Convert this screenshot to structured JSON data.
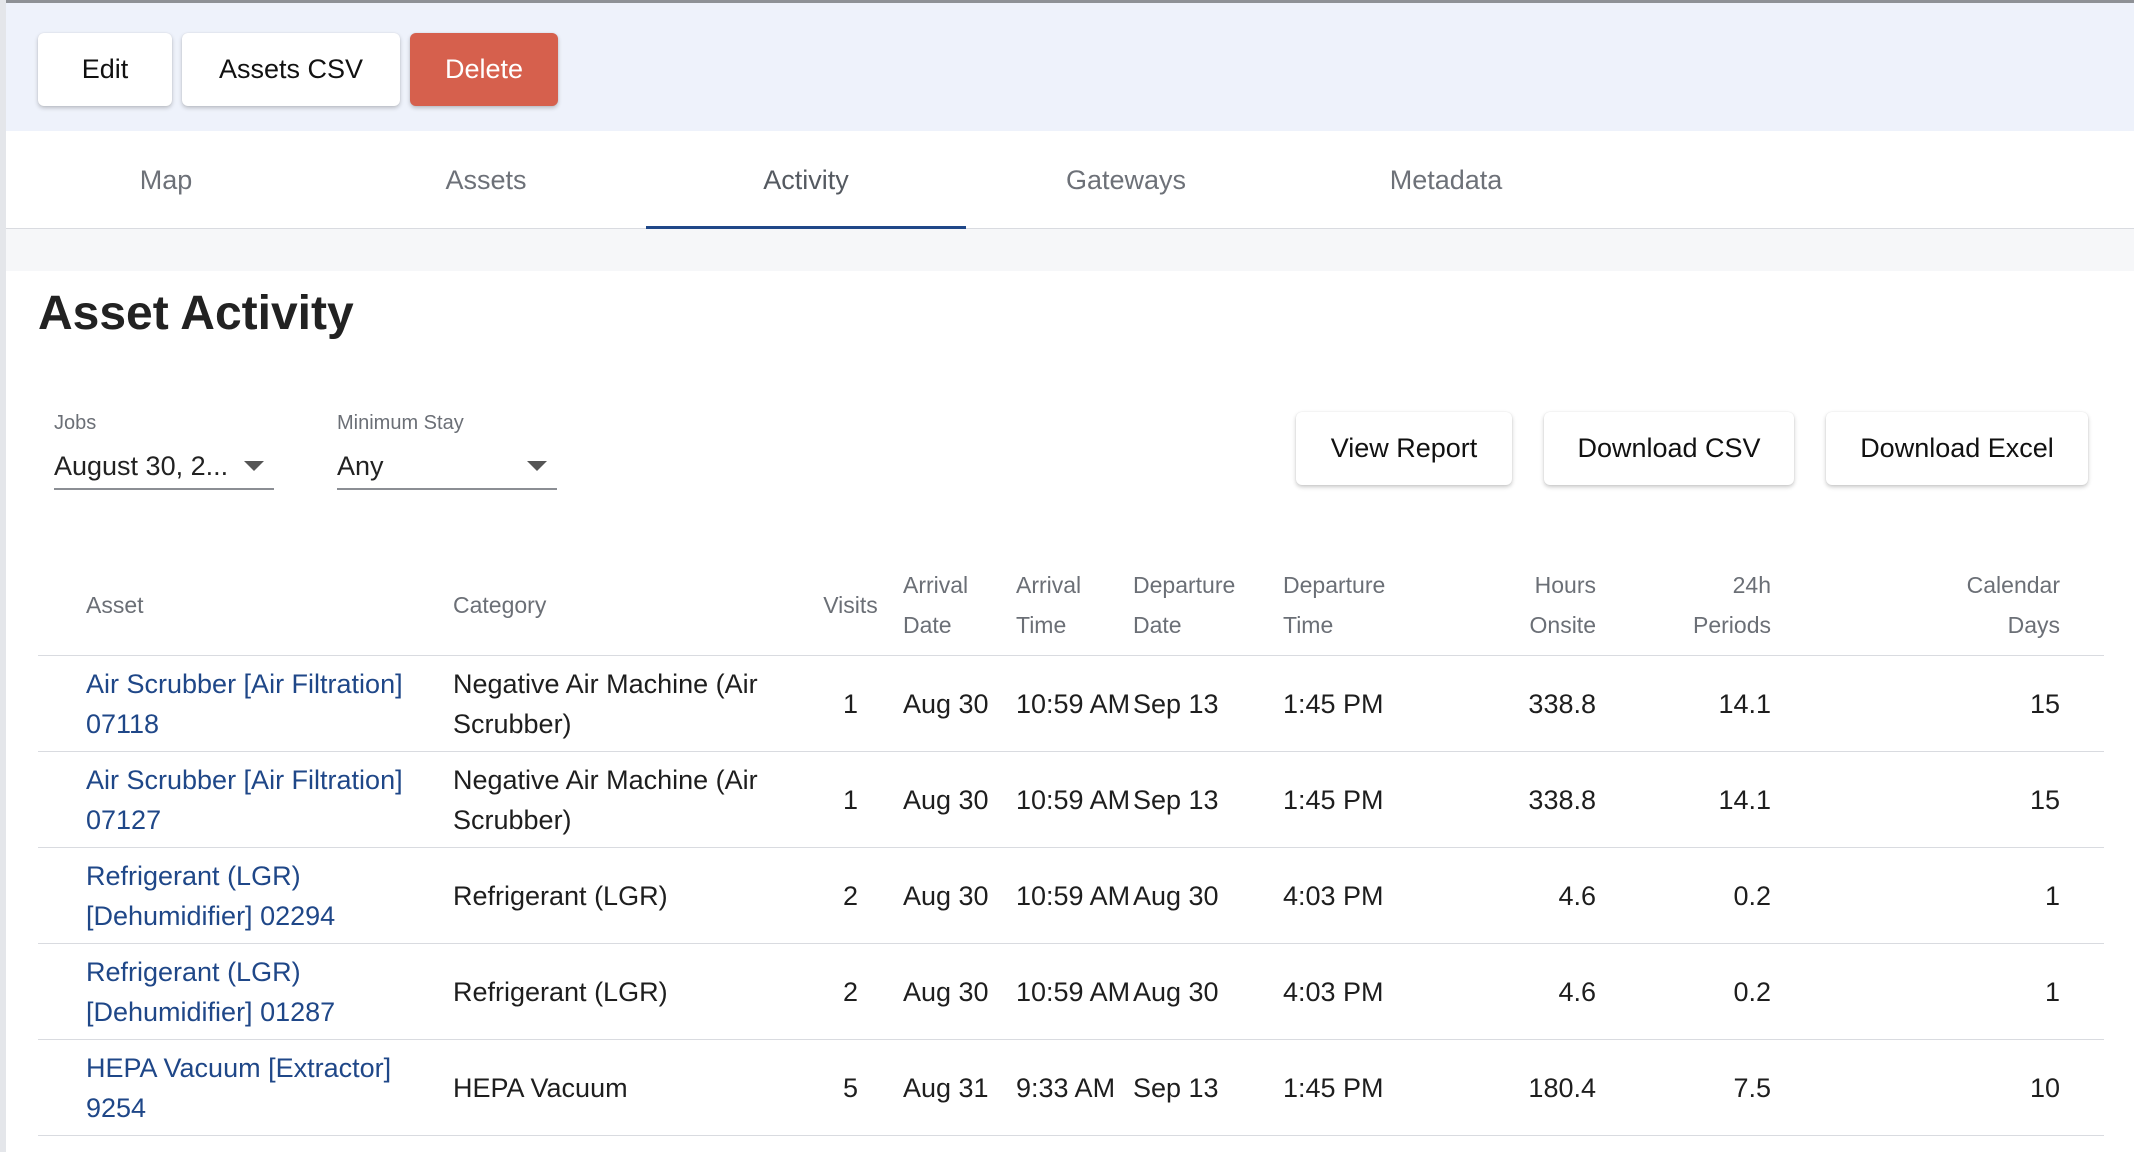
{
  "toolbar": {
    "edit_label": "Edit",
    "assets_csv_label": "Assets CSV",
    "delete_label": "Delete",
    "delete_color": "#d6604d"
  },
  "tabs": [
    {
      "label": "Map",
      "active": false
    },
    {
      "label": "Assets",
      "active": false
    },
    {
      "label": "Activity",
      "active": true
    },
    {
      "label": "Gateways",
      "active": false
    },
    {
      "label": "Metadata",
      "active": false
    }
  ],
  "accent_color": "#1f4788",
  "page_title": "Asset Activity",
  "filters": {
    "jobs": {
      "label": "Jobs",
      "value": "August 30, 2..."
    },
    "minimum_stay": {
      "label": "Minimum Stay",
      "value": "Any"
    }
  },
  "actions": {
    "view_report": "View Report",
    "download_csv": "Download CSV",
    "download_excel": "Download Excel"
  },
  "table": {
    "headers": {
      "asset": "Asset",
      "category": "Category",
      "visits": "Visits",
      "arrival_date": [
        "Arrival",
        "Date"
      ],
      "arrival_time": [
        "Arrival",
        "Time"
      ],
      "departure_date": [
        "Departure",
        "Date"
      ],
      "departure_time": [
        "Departure",
        "Time"
      ],
      "hours_onsite": [
        "Hours",
        "Onsite"
      ],
      "periods_24h": [
        "24h",
        "Periods"
      ],
      "calendar_days": [
        "Calendar",
        "Days"
      ]
    },
    "rows": [
      {
        "asset": "Air Scrubber [Air Filtration] 07118",
        "category": "Negative Air Machine (Air Scrubber)",
        "visits": "1",
        "arrival_date": "Aug 30",
        "arrival_time": "10:59 AM",
        "departure_date": "Sep 13",
        "departure_time": "1:45 PM",
        "hours_onsite": "338.8",
        "periods_24h": "14.1",
        "calendar_days": "15"
      },
      {
        "asset": "Air Scrubber [Air Filtration] 07127",
        "category": "Negative Air Machine (Air Scrubber)",
        "visits": "1",
        "arrival_date": "Aug 30",
        "arrival_time": "10:59 AM",
        "departure_date": "Sep 13",
        "departure_time": "1:45 PM",
        "hours_onsite": "338.8",
        "periods_24h": "14.1",
        "calendar_days": "15"
      },
      {
        "asset": "Refrigerant (LGR) [Dehumidifier] 02294",
        "category": "Refrigerant (LGR)",
        "visits": "2",
        "arrival_date": "Aug 30",
        "arrival_time": "10:59 AM",
        "departure_date": "Aug 30",
        "departure_time": "4:03 PM",
        "hours_onsite": "4.6",
        "periods_24h": "0.2",
        "calendar_days": "1"
      },
      {
        "asset": "Refrigerant (LGR) [Dehumidifier] 01287",
        "category": "Refrigerant (LGR)",
        "visits": "2",
        "arrival_date": "Aug 30",
        "arrival_time": "10:59 AM",
        "departure_date": "Aug 30",
        "departure_time": "4:03 PM",
        "hours_onsite": "4.6",
        "periods_24h": "0.2",
        "calendar_days": "1"
      },
      {
        "asset": "HEPA Vacuum [Extractor] 9254",
        "category": "HEPA Vacuum",
        "visits": "5",
        "arrival_date": "Aug 31",
        "arrival_time": "9:33 AM",
        "departure_date": "Sep 13",
        "departure_time": "1:45 PM",
        "hours_onsite": "180.4",
        "periods_24h": "7.5",
        "calendar_days": "10"
      }
    ]
  }
}
